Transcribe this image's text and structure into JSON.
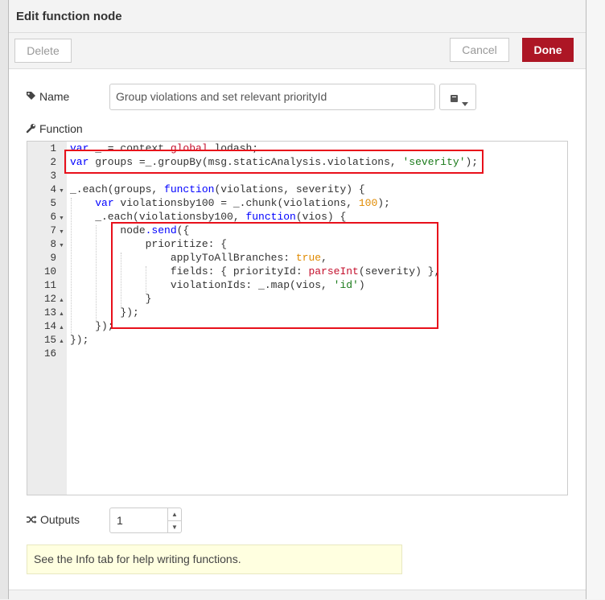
{
  "dialog": {
    "title": "Edit function node"
  },
  "toolbar": {
    "delete_label": "Delete",
    "cancel_label": "Cancel",
    "done_label": "Done"
  },
  "name": {
    "label": "Name",
    "value": "Group violations and set relevant priorityId",
    "icon": "tag-icon"
  },
  "function_section": {
    "label": "Function",
    "icon": "wrench-icon"
  },
  "editor": {
    "line_numbers": [
      "1",
      "2",
      "3",
      "4",
      "5",
      "6",
      "7",
      "8",
      "9",
      "10",
      "11",
      "12",
      "13",
      "14",
      "15",
      "16"
    ],
    "lines": [
      "var _ = context.global.lodash;",
      "var groups =_.groupBy(msg.staticAnalysis.violations, 'severity');",
      "",
      "_.each(groups, function(violations, severity) {",
      "    var violationsby100 = _.chunk(violations, 100);",
      "    _.each(violationsby100, function(vios) {",
      "        node.send({",
      "            prioritize: {",
      "                applyToAllBranches: true,",
      "                fields: { priorityId: parseInt(severity) },",
      "                violationIds: _.map(vios, 'id')",
      "            }",
      "        });",
      "    });",
      "});",
      ""
    ]
  },
  "outputs": {
    "label": "Outputs",
    "value": "1"
  },
  "info": {
    "text": "See the Info tab for help writing functions."
  },
  "colors": {
    "done_button": "#ad1625",
    "highlight_box": "#e8101b",
    "info_bg": "#ffffe0"
  }
}
